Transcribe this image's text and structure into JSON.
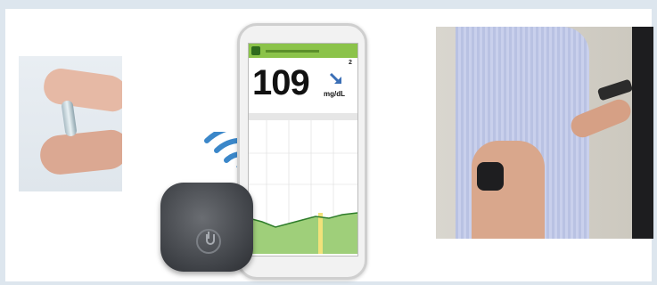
{
  "phone_app": {
    "glucose_value": "109",
    "glucose_unit": "mg/dL",
    "trend_icon": "trend-arrow-down-right-icon",
    "status_value": "2"
  },
  "colors": {
    "app_bar": "#8bc34a",
    "chart_fill": "#9fcf7a",
    "chart_line": "#2f7d2b",
    "target_band": "#f2e27a",
    "wifi": "#3b87c9",
    "transmitter": "#4a4d52",
    "background": "#dde6ee"
  },
  "icons": [
    "wifi-signal-icon",
    "power-icon",
    "trend-arrow-down-right-icon"
  ]
}
